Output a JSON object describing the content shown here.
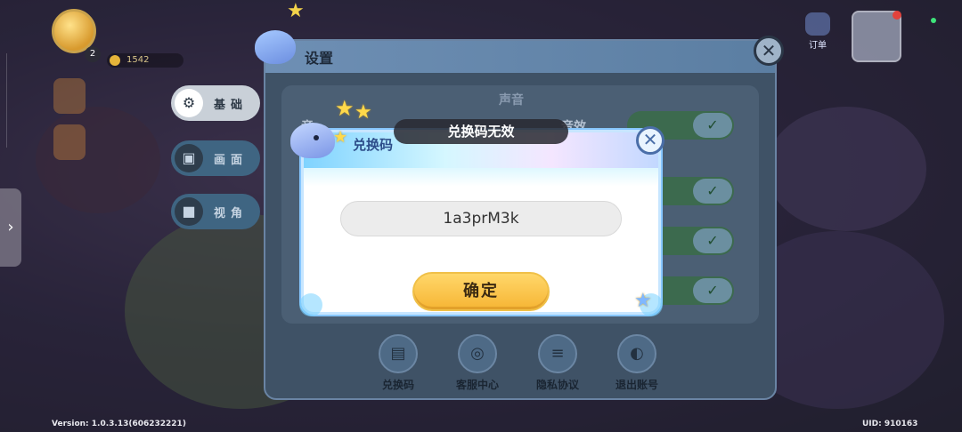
{
  "hud": {
    "avatar_level": "2",
    "coins": "1542",
    "order_label": "订单"
  },
  "side_tab": {
    "icon": "chevron-right-icon",
    "glyph": "›"
  },
  "settings": {
    "title": "设置",
    "close_glyph": "✕",
    "section_sound": "声音",
    "row_left_label": "音",
    "row_right_label": "音效",
    "toggles": [
      {
        "glyph": "✓",
        "state": "on"
      },
      {
        "glyph": "✓",
        "state": "on"
      },
      {
        "glyph": "✓",
        "state": "on"
      },
      {
        "glyph": "✓",
        "state": "on"
      }
    ],
    "tabs": [
      {
        "label": "基础",
        "icon": "gear-icon",
        "glyph": "⚙",
        "active": true
      },
      {
        "label": "画面",
        "icon": "picture-icon",
        "glyph": "▣",
        "active": false
      },
      {
        "label": "视角",
        "icon": "camera-icon",
        "glyph": "■",
        "active": false
      }
    ],
    "actions": [
      {
        "label": "兑换码",
        "icon": "ticket-icon",
        "glyph": "▤"
      },
      {
        "label": "客服中心",
        "icon": "headset-icon",
        "glyph": "◎"
      },
      {
        "label": "隐私协议",
        "icon": "document-icon",
        "glyph": "≡"
      },
      {
        "label": "退出账号",
        "icon": "logout-icon",
        "glyph": "◐"
      }
    ]
  },
  "redeem_dialog": {
    "title": "兑换码",
    "code_value": "1a3prM3k",
    "confirm_label": "确定",
    "close_glyph": "✕"
  },
  "toast": {
    "message": "兑换码无效"
  },
  "footer": {
    "version": "Version: 1.0.3.13(606232221)",
    "uid": "UID: 910163"
  },
  "colors": {
    "confirm_button": "#f6b534",
    "toggle_on": "#3c6a4e",
    "toast_bg": "#28282e",
    "dialog_border": "#86c6ff"
  }
}
